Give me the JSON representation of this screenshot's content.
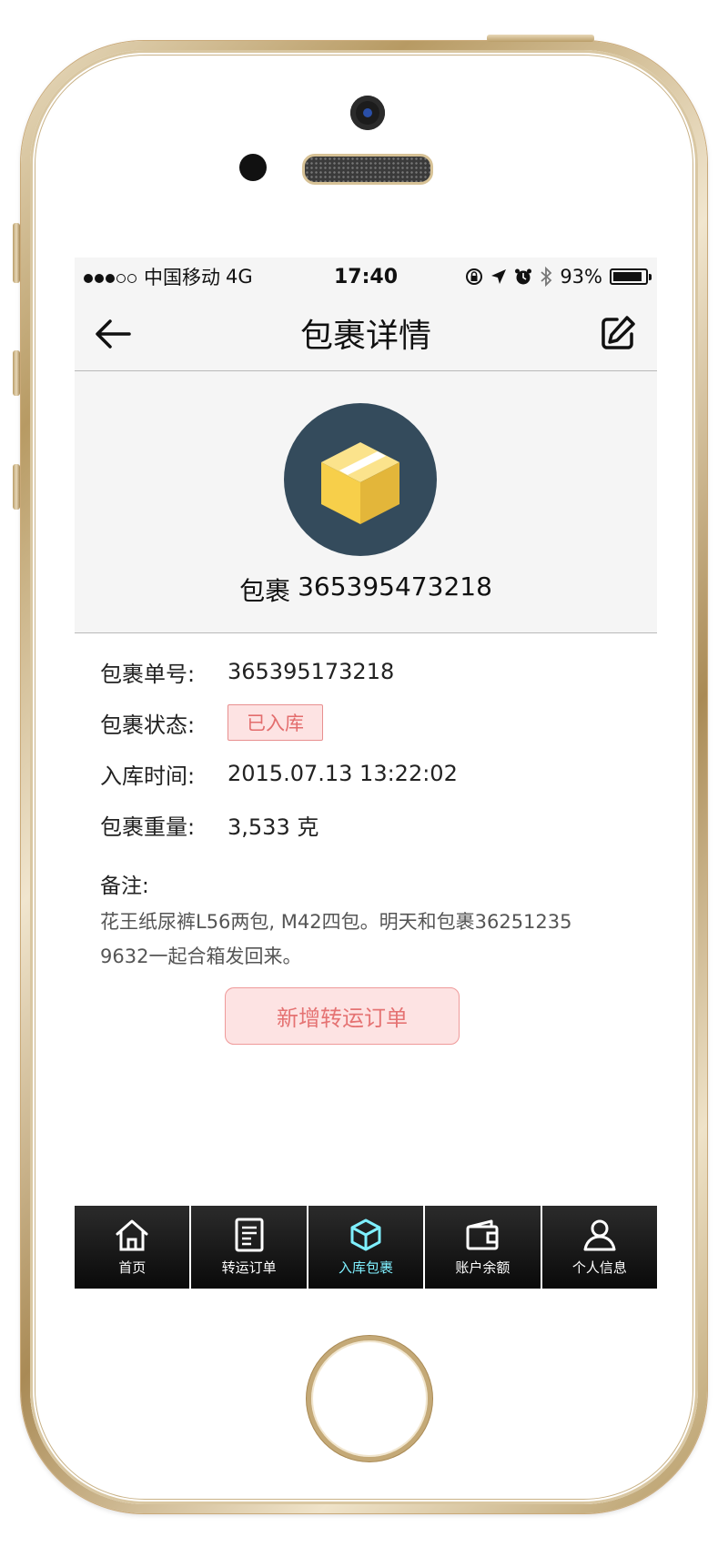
{
  "status_bar": {
    "carrier": "中国移动",
    "network": "4G",
    "time": "17:40",
    "battery": "93%",
    "signal_dots": 5,
    "signal_level": 3
  },
  "nav": {
    "title": "包裹详情",
    "back_icon": "arrow-left-icon",
    "edit_icon": "edit-icon"
  },
  "hero": {
    "prefix": "包裹",
    "number": "365395473218",
    "icon": "package-box-icon"
  },
  "details": [
    {
      "label": "包裹单号:",
      "value": "365395173218"
    },
    {
      "label": "包裹状态:",
      "value": "已入库"
    },
    {
      "label": "入库时间:",
      "value": "2015.07.13 13:22:02"
    },
    {
      "label": "包裹重量:",
      "value": "3,533 克"
    }
  ],
  "remark": {
    "label": "备注:",
    "text": "花王纸尿裤L56两包, M42四包。明天和包裹362512359632一起合箱发回来。"
  },
  "action_button": "新增转运订单",
  "tabs": [
    {
      "label": "首页",
      "icon": "home-icon",
      "active": false
    },
    {
      "label": "转运订单",
      "icon": "document-icon",
      "active": false
    },
    {
      "label": "入库包裹",
      "icon": "cube-icon",
      "active": true
    },
    {
      "label": "账户余额",
      "icon": "wallet-icon",
      "active": false
    },
    {
      "label": "个人信息",
      "icon": "user-icon",
      "active": false
    }
  ],
  "colors": {
    "accent_tab": "#7ff0ff",
    "badge_bg": "#fde3e3",
    "badge_text": "#e36d6d",
    "hero_circle": "#344b5c",
    "box_yellow": "#f9d55a"
  }
}
